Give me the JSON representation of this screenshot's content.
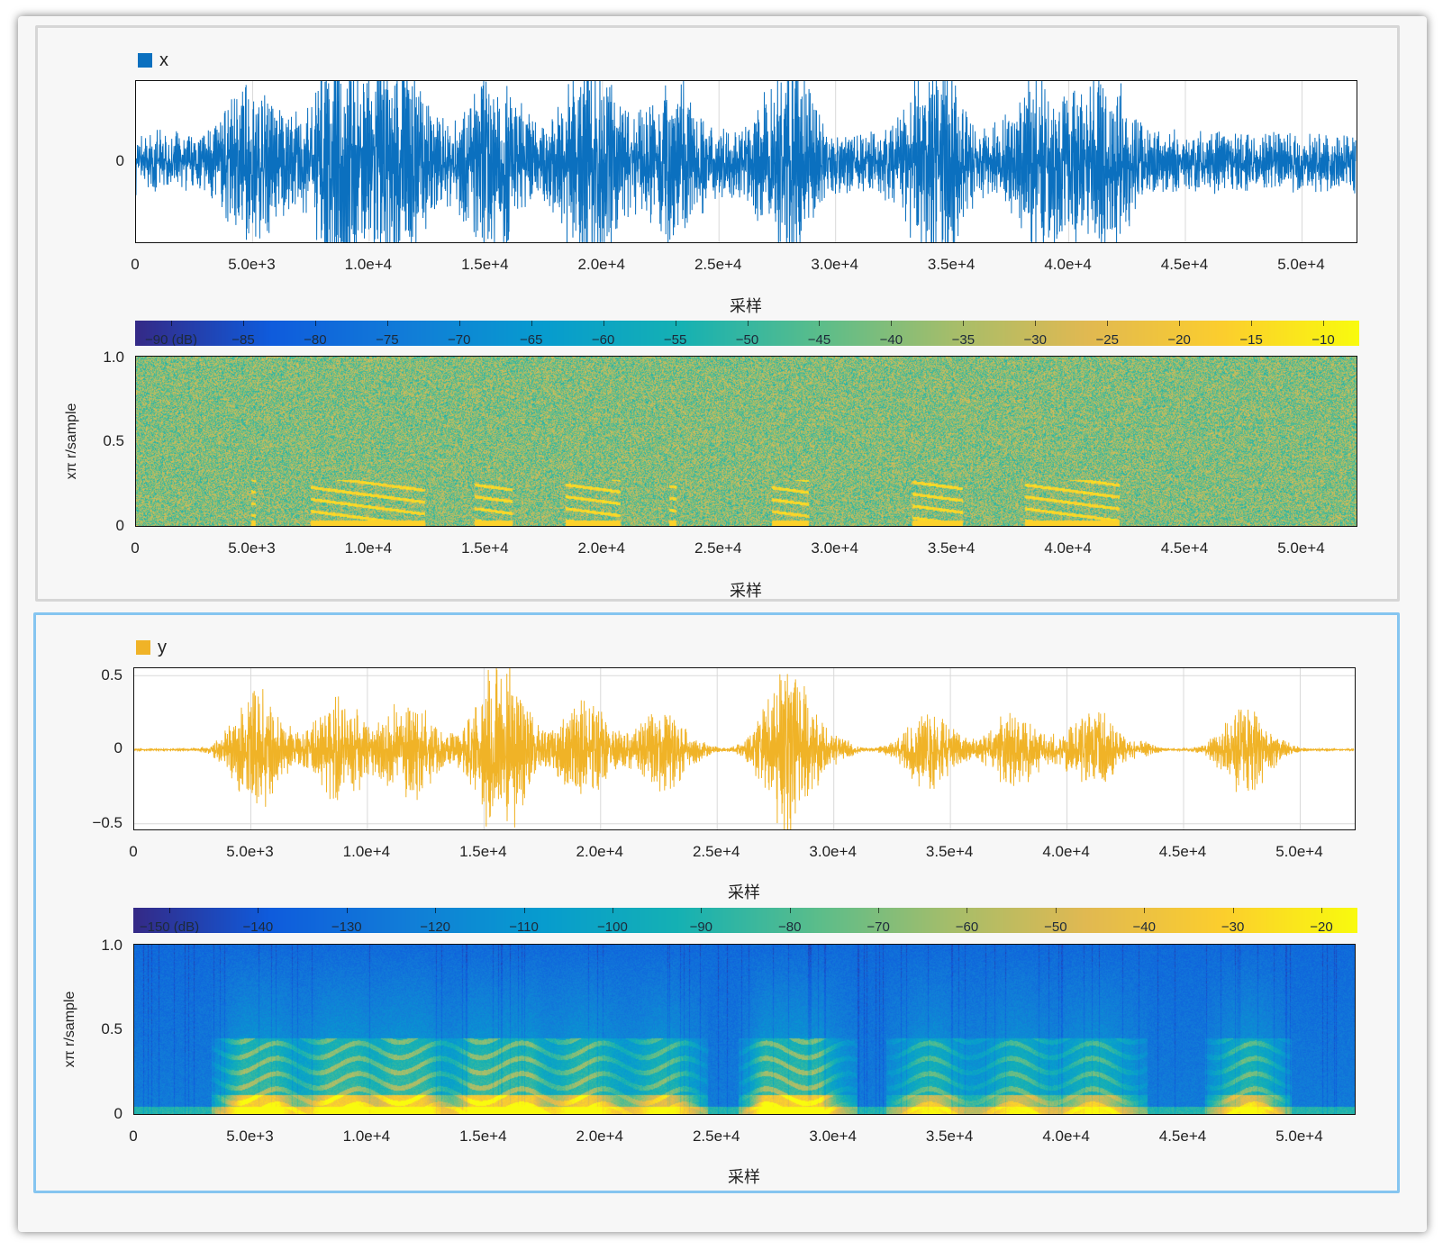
{
  "panels": [
    {
      "id": "x",
      "active": false,
      "legend": {
        "label": "x",
        "color": "#0b70bf"
      },
      "waveform": {
        "xlabel": "采样",
        "xticks": [
          "0",
          "5.0e+3",
          "1.0e+4",
          "1.5e+4",
          "2.0e+4",
          "2.5e+4",
          "3.0e+4",
          "3.5e+4",
          "4.0e+4",
          "4.5e+4",
          "5.0e+4"
        ],
        "yticks": [
          "0"
        ]
      },
      "colorbar": {
        "ticks": [
          "−90 (dB)",
          "−85",
          "−80",
          "−75",
          "−70",
          "−65",
          "−60",
          "−55",
          "−50",
          "−45",
          "−40",
          "−35",
          "−30",
          "−25",
          "−20",
          "−15",
          "−10"
        ]
      },
      "spectrogram": {
        "xlabel": "采样",
        "ylabel": "xπ r/sample",
        "xticks": [
          "0",
          "5.0e+3",
          "1.0e+4",
          "1.5e+4",
          "2.0e+4",
          "2.5e+4",
          "3.0e+4",
          "3.5e+4",
          "4.0e+4",
          "4.5e+4",
          "5.0e+4"
        ],
        "yticks": [
          "1.0",
          "0.5",
          "0"
        ]
      }
    },
    {
      "id": "y",
      "active": true,
      "legend": {
        "label": "y",
        "color": "#f0b327"
      },
      "waveform": {
        "xlabel": "采样",
        "xticks": [
          "0",
          "5.0e+3",
          "1.0e+4",
          "1.5e+4",
          "2.0e+4",
          "2.5e+4",
          "3.0e+4",
          "3.5e+4",
          "4.0e+4",
          "4.5e+4",
          "5.0e+4"
        ],
        "yticks": [
          "0.5",
          "0",
          "−0.5"
        ]
      },
      "colorbar": {
        "ticks": [
          "−150 (dB)",
          "−140",
          "−130",
          "−120",
          "−110",
          "−100",
          "−90",
          "−80",
          "−70",
          "−60",
          "−50",
          "−40",
          "−30",
          "−20"
        ]
      },
      "spectrogram": {
        "xlabel": "采样",
        "ylabel": "xπ r/sample",
        "xticks": [
          "0",
          "5.0e+3",
          "1.0e+4",
          "1.5e+4",
          "2.0e+4",
          "2.5e+4",
          "3.0e+4",
          "3.5e+4",
          "4.0e+4",
          "4.5e+4",
          "5.0e+4"
        ],
        "yticks": [
          "1.0",
          "0.5",
          "0"
        ]
      }
    }
  ],
  "chart_data": [
    {
      "type": "line",
      "series": [
        {
          "name": "x",
          "color": "#0b70bf"
        }
      ],
      "xlabel": "采样",
      "ylabel": "",
      "xlim": [
        0,
        52300
      ],
      "ylim": [
        -0.6,
        0.6
      ],
      "grid": true,
      "legend": "top-left",
      "bursts": [
        {
          "center": 5000,
          "amplitude": 0.3
        },
        {
          "center": 8700,
          "amplitude": 0.55
        },
        {
          "center": 11300,
          "amplitude": 0.48
        },
        {
          "center": 15300,
          "amplitude": 0.4
        },
        {
          "center": 19500,
          "amplitude": 0.52
        },
        {
          "center": 23000,
          "amplitude": 0.3
        },
        {
          "center": 28000,
          "amplitude": 0.4
        },
        {
          "center": 34300,
          "amplitude": 0.5
        },
        {
          "center": 38800,
          "amplitude": 0.38
        },
        {
          "center": 41500,
          "amplitude": 0.35
        }
      ],
      "noise_floor": 0.17
    },
    {
      "type": "heatmap",
      "series": [
        {
          "name": "x"
        }
      ],
      "xlabel": "采样",
      "ylabel": "xπ r/sample",
      "xlim": [
        0,
        52300
      ],
      "ylim": [
        0,
        1.0
      ],
      "color_range_db": [
        -92,
        -8
      ]
    },
    {
      "type": "line",
      "series": [
        {
          "name": "y",
          "color": "#f0b327"
        }
      ],
      "xlabel": "采样",
      "ylabel": "",
      "xlim": [
        0,
        52300
      ],
      "ylim": [
        -0.55,
        0.55
      ],
      "grid": true,
      "legend": "top-left",
      "bursts": [
        {
          "center": 5300,
          "amplitude": 0.3
        },
        {
          "center": 8800,
          "amplitude": 0.27
        },
        {
          "center": 11800,
          "amplitude": 0.28
        },
        {
          "center": 15700,
          "amplitude": 0.5
        },
        {
          "center": 19300,
          "amplitude": 0.25
        },
        {
          "center": 22700,
          "amplitude": 0.22
        },
        {
          "center": 28100,
          "amplitude": 0.45
        },
        {
          "center": 30400,
          "amplitude": 0.04
        },
        {
          "center": 34100,
          "amplitude": 0.2
        },
        {
          "center": 37800,
          "amplitude": 0.2
        },
        {
          "center": 41100,
          "amplitude": 0.2
        },
        {
          "center": 43300,
          "amplitude": 0.03
        },
        {
          "center": 47700,
          "amplitude": 0.22
        }
      ],
      "noise_floor": 0.004
    },
    {
      "type": "heatmap",
      "series": [
        {
          "name": "y"
        }
      ],
      "xlabel": "采样",
      "ylabel": "xπ r/sample",
      "xlim": [
        0,
        52300
      ],
      "ylim": [
        0,
        1.0
      ],
      "color_range_db": [
        -158,
        -12
      ]
    }
  ]
}
